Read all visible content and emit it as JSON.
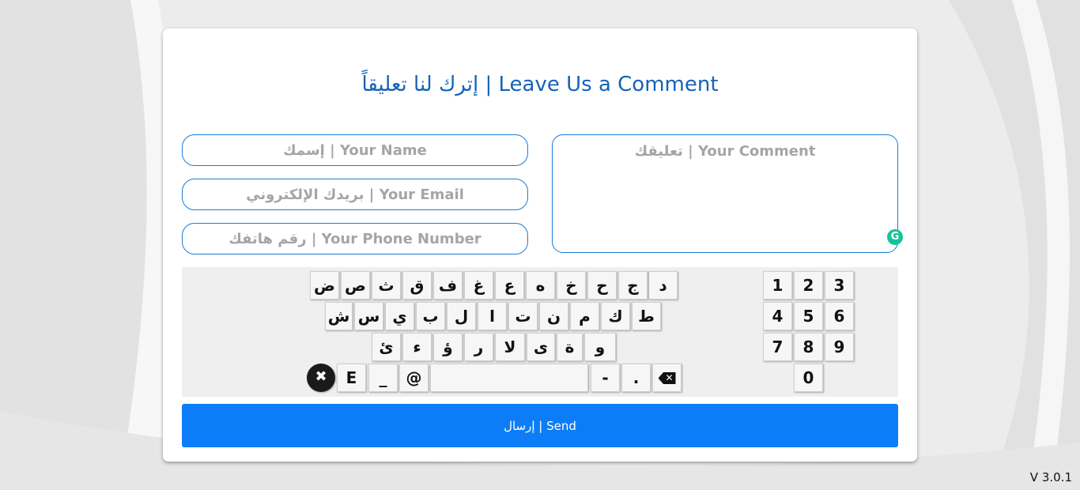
{
  "form": {
    "title": "إترك لنا تعليقاً | Leave Us a Comment",
    "name_placeholder": "إسمك | Your Name",
    "email_placeholder": "بريدك الإلكتروني | Your Email",
    "phone_placeholder": "رقم هاتفك | Your Phone Number",
    "comment_placeholder": "تعليقك | Your Comment",
    "send_label": "إرسال | Send",
    "grammarly_label": "G"
  },
  "keyboard": {
    "row1": [
      "ض",
      "ص",
      "ث",
      "ق",
      "ف",
      "غ",
      "ع",
      "ه",
      "خ",
      "ح",
      "ج",
      "د"
    ],
    "row2": [
      "ش",
      "س",
      "ي",
      "ب",
      "ل",
      "ا",
      "ت",
      "ن",
      "م",
      "ك",
      "ط"
    ],
    "row3": [
      "ئ",
      "ء",
      "ؤ",
      "ر",
      "لا",
      "ى",
      "ة",
      "و"
    ],
    "row4": {
      "clear": "✖",
      "e": "E",
      "underscore": "_",
      "at": "@",
      "space": "",
      "dash": "-",
      "dot": "."
    },
    "numpad": [
      "1",
      "2",
      "3",
      "4",
      "5",
      "6",
      "7",
      "8",
      "9",
      "0"
    ]
  },
  "footer": {
    "version": "V 3.0.1"
  },
  "colors": {
    "accent": "#0d7df7",
    "title": "#1563b8",
    "border": "#1a7bd6"
  }
}
